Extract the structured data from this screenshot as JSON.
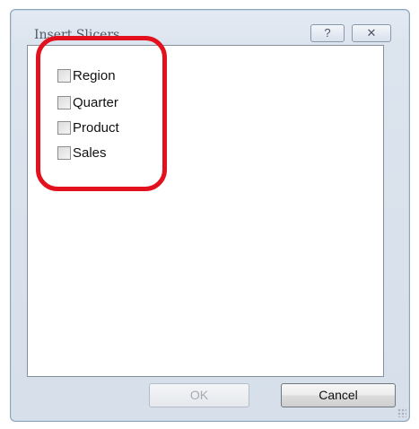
{
  "dialog": {
    "title": "Insert Slicers",
    "help_glyph": "?",
    "close_glyph": "✕"
  },
  "fields": [
    {
      "label": "Region",
      "checked": false
    },
    {
      "label": "Quarter",
      "checked": false
    },
    {
      "label": "Product",
      "checked": false
    },
    {
      "label": "Sales",
      "checked": false
    }
  ],
  "buttons": {
    "ok_label": "OK",
    "cancel_label": "Cancel"
  },
  "colors": {
    "highlight": "#e3101d",
    "dialog_bg": "#dce4ee"
  },
  "icons": {
    "help": "question-mark-icon",
    "close": "close-icon",
    "resize": "resize-grip-icon"
  }
}
